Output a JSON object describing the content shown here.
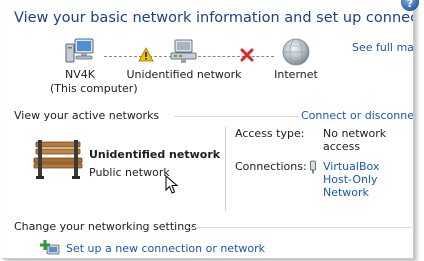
{
  "header": {
    "title": "View your basic network information and set up connections",
    "help_glyph": "?",
    "see_full_map": "See full map"
  },
  "map": {
    "nodes": [
      {
        "label_line1": "NV4K",
        "label_line2": "(This computer)",
        "icon": "computer-icon"
      },
      {
        "label_line1": "Unidentified network",
        "label_line2": "",
        "icon": "network-icon"
      },
      {
        "label_line1": "Internet",
        "label_line2": "",
        "icon": "globe-icon"
      }
    ],
    "links": [
      {
        "status": "warning",
        "icon": "warning-icon"
      },
      {
        "status": "disconnected",
        "icon": "red-x-icon"
      }
    ]
  },
  "active_networks": {
    "heading": "View your active networks",
    "action": "Connect or disconnect",
    "network_name": "Unidentified network",
    "network_type": "Public network",
    "icon": "park-bench-icon",
    "access_type_label": "Access type:",
    "access_type_value": "No network access",
    "connections_label": "Connections:",
    "connections_value": "VirtualBox Host-Only Network",
    "connections_icon": "network-adapter-icon"
  },
  "settings": {
    "heading": "Change your networking settings",
    "setup_link": "Set up a new connection or network",
    "setup_icon": "add-connection-icon"
  },
  "colors": {
    "title": "#1e3f8a",
    "link": "#1a56b8",
    "warning": "#f2c200",
    "error": "#d9262c"
  }
}
